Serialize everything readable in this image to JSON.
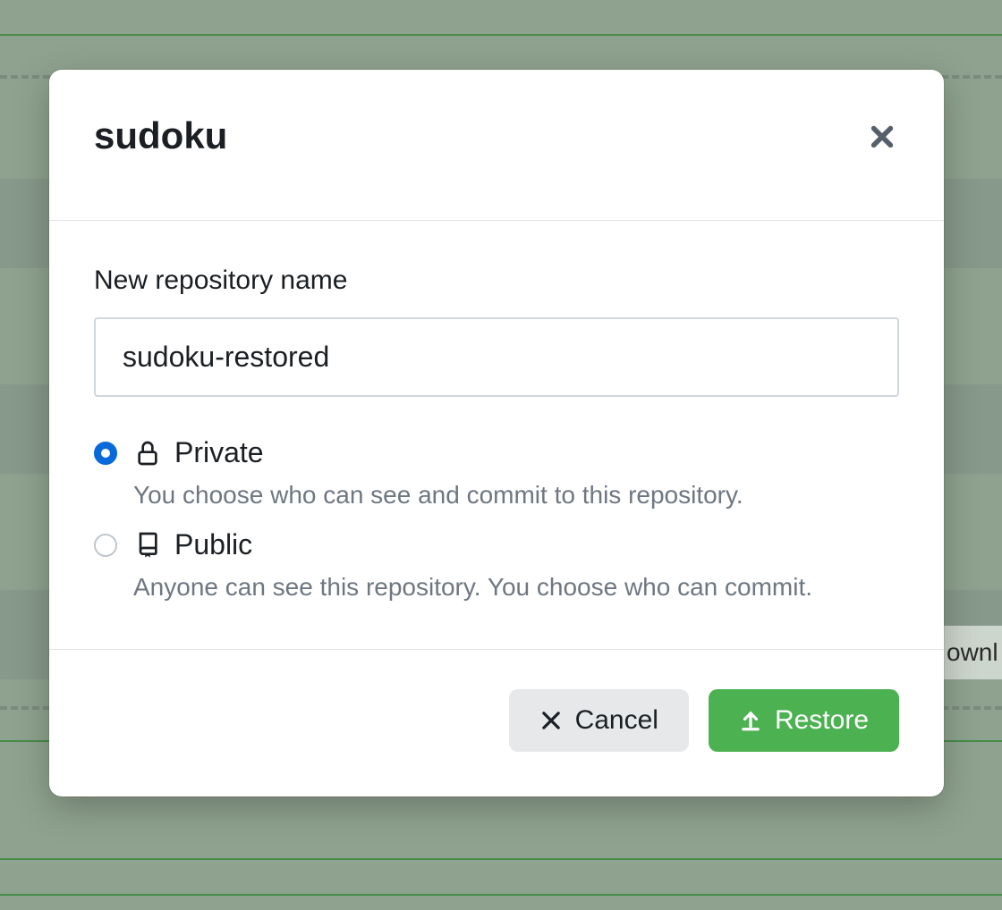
{
  "modal": {
    "title": "sudoku",
    "form": {
      "name_label": "New repository name",
      "name_value": "sudoku-restored",
      "visibility": {
        "selected": "private",
        "private": {
          "label": "Private",
          "description": "You choose who can see and commit to this repository."
        },
        "public": {
          "label": "Public",
          "description": "Anyone can see this repository. You choose who can commit."
        }
      }
    },
    "actions": {
      "cancel": "Cancel",
      "restore": "Restore"
    }
  },
  "background": {
    "chip_text": "ownl"
  },
  "colors": {
    "overlay": "#8fa28f",
    "accent_blue": "#0969da",
    "accent_green": "#4cb150",
    "rule_green": "#187f1a"
  }
}
